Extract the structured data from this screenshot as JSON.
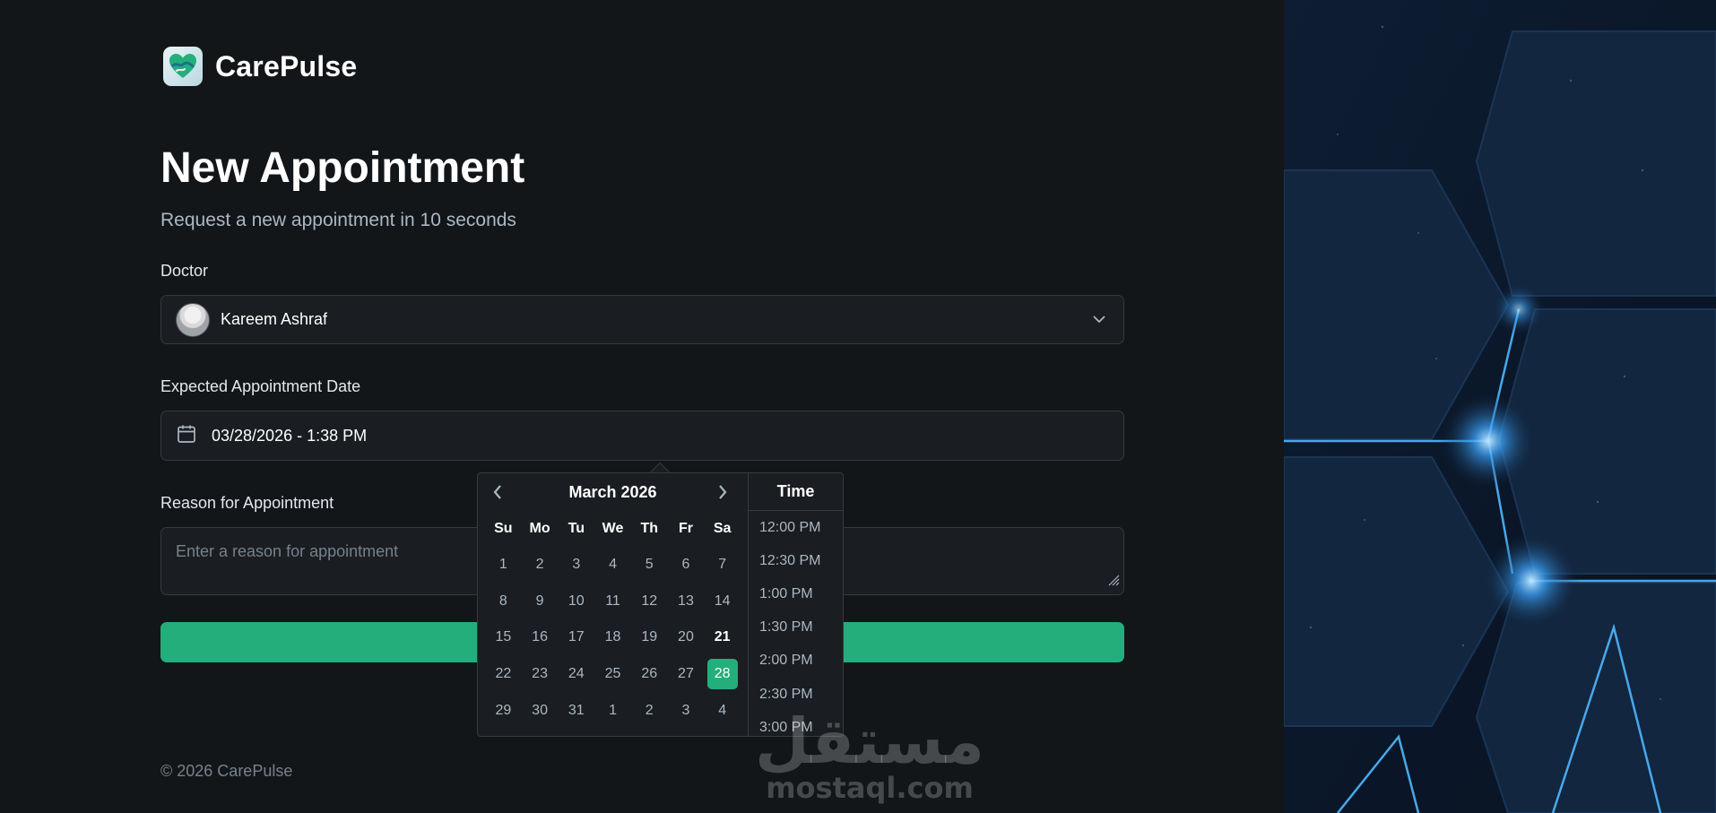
{
  "brand": {
    "name": "CarePulse",
    "logo_icon": "heart-hands-icon"
  },
  "page": {
    "title": "New Appointment",
    "subtitle": "Request a new appointment in 10 seconds"
  },
  "form": {
    "doctor": {
      "label": "Doctor",
      "value": "Kareem Ashraf"
    },
    "date": {
      "label": "Expected Appointment Date",
      "value": "03/28/2026 - 1:38 PM"
    },
    "reason": {
      "label": "Reason for Appointment",
      "placeholder": "Enter a reason for appointment"
    },
    "submit_label": ""
  },
  "datepicker": {
    "month_label": "March 2026",
    "weekdays": [
      "Su",
      "Mo",
      "Tu",
      "We",
      "Th",
      "Fr",
      "Sa"
    ],
    "weeks": [
      [
        "1",
        "2",
        "3",
        "4",
        "5",
        "6",
        "7"
      ],
      [
        "8",
        "9",
        "10",
        "11",
        "12",
        "13",
        "14"
      ],
      [
        "15",
        "16",
        "17",
        "18",
        "19",
        "20",
        "21"
      ],
      [
        "22",
        "23",
        "24",
        "25",
        "26",
        "27",
        "28"
      ],
      [
        "29",
        "30",
        "31",
        "1",
        "2",
        "3",
        "4"
      ]
    ],
    "today": "21",
    "selected": "28",
    "time_header": "Time",
    "times": [
      "12:00 PM",
      "12:30 PM",
      "1:00 PM",
      "1:30 PM",
      "2:00 PM",
      "2:30 PM",
      "3:00 PM"
    ]
  },
  "footer": {
    "copyright": "© 2026 CarePulse"
  },
  "watermark": {
    "arabic": "مستقل",
    "latin": "mostaql.com"
  },
  "colors": {
    "accent": "#24ae7c",
    "background": "#131619",
    "field": "#1a1d21",
    "border": "#363a3d"
  }
}
